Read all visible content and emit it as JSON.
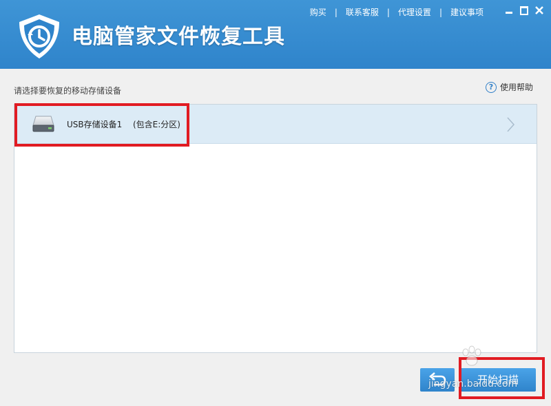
{
  "app": {
    "title": "电脑管家文件恢复工具"
  },
  "topnav": {
    "links": [
      "购买",
      "联系客服",
      "代理设置",
      "建议事项"
    ],
    "separator": "|"
  },
  "content": {
    "prompt": "请选择要恢复的移动存储设备",
    "help_label": "使用帮助",
    "help_icon_glyph": "?"
  },
  "devices": [
    {
      "name": "USB存储设备1",
      "partition": "(包含E:分区)",
      "icon": "hard-drive-icon"
    }
  ],
  "buttons": {
    "scan_label": "开始扫描",
    "back_icon": "return-arrow-icon"
  },
  "watermark": {
    "text": "jingyan.baidu.com"
  },
  "colors": {
    "header": "#2f84cb",
    "selected_row": "#dcebf6",
    "highlight": "#e11b22",
    "button": "#2f84cb"
  }
}
